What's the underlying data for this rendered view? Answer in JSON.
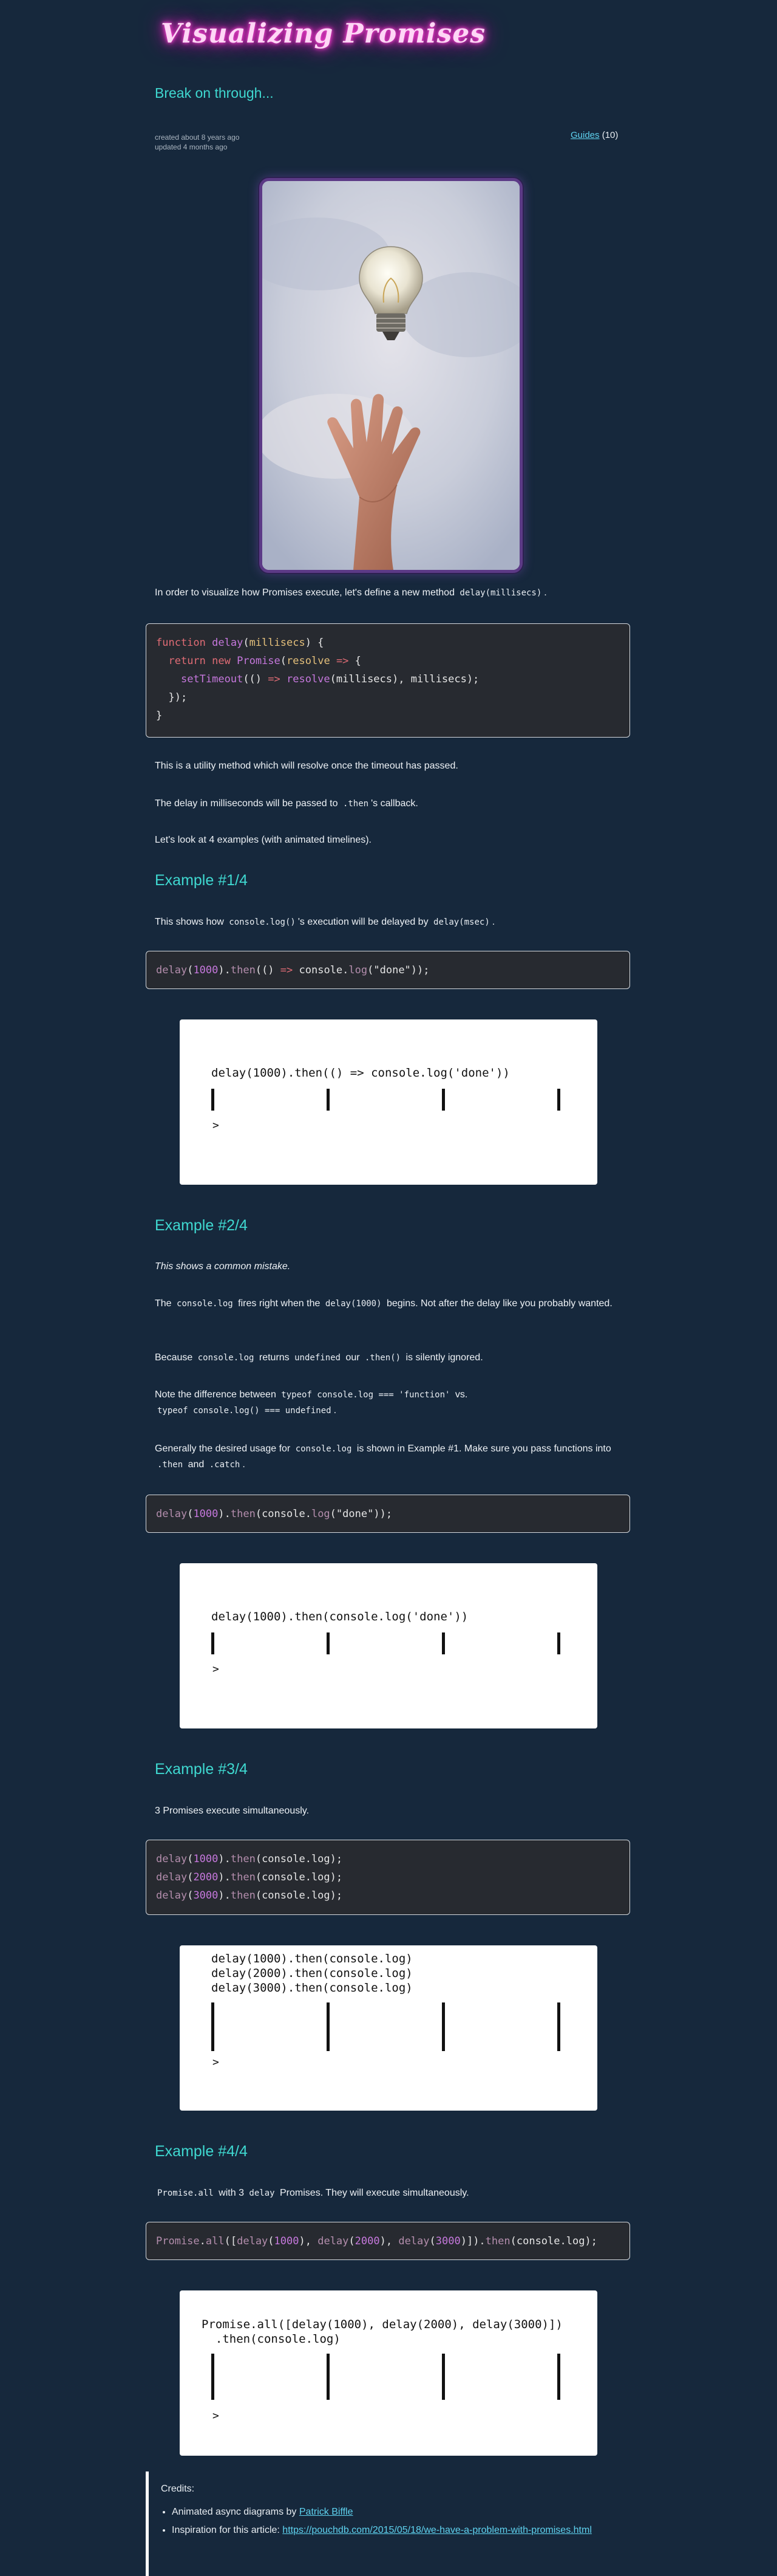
{
  "header": {
    "site_title": "Visualizing Promises",
    "tagline": "Break on through...",
    "created": "created about 8 years ago",
    "updated": "updated 4 months ago",
    "guides_label": "Guides",
    "guides_count": "(10)"
  },
  "intro": {
    "p1_before": "In order to visualize how Promises execute, let's define a new method ",
    "p1_code": "delay(millisecs)",
    "p1_after": ".",
    "p2": "This is a utility method which will resolve once the timeout has passed.",
    "p3_before": "The delay in milliseconds will be passed to ",
    "p3_code": ".then",
    "p3_after": "'s callback.",
    "p4": "Let's look at 4 examples (with animated timelines)."
  },
  "code_delay": {
    "l1_kw": "function",
    "l1_fn": "delay",
    "l1_open": "(",
    "l1_param": "millisecs",
    "l1_close": ") {",
    "l2_kw1": "return",
    "l2_kw2": "new",
    "l2_cls": "Promise",
    "l2_open": "(",
    "l2_param": "resolve",
    "l2_arrow": "=>",
    "l2_brace": " {",
    "l3_fn": "setTimeout",
    "l3_open": "(() ",
    "l3_arrow": "=>",
    "l3_fn2": "resolve",
    "l3_rest": "(millisecs), millisecs);",
    "l4": "});",
    "l5": "}"
  },
  "ex1": {
    "title": "Example #1/4",
    "p_before": "This shows how ",
    "p_code": "console.log()",
    "p_mid": "'s execution will be delayed by ",
    "p_code2": "delay(msec)",
    "p_after": ".",
    "code_fn": "delay",
    "code_num": "1000",
    "code_then": "then",
    "code_arrow": "=>",
    "code_log": "console.",
    "code_logfn": "log",
    "code_str": "\"done\"",
    "code_end": "));",
    "anim_caption": "delay(1000).then(() => console.log('done'))",
    "anim_prompt": ">"
  },
  "ex2": {
    "title": "Example #2/4",
    "italic": "This shows a common mistake.",
    "p1_a": "The ",
    "p1_code": "console.log",
    "p1_b": " fires right when the ",
    "p1_code2": "delay(1000)",
    "p1_c": " begins. Not after the delay like you probably wanted.",
    "p2_a": "Because ",
    "p2_code": "console.log",
    "p2_b": " returns ",
    "p2_code2": "undefined",
    "p2_c": " our ",
    "p2_code3": ".then()",
    "p2_d": " is silently ignored.",
    "p3_a": "Note the difference between ",
    "p3_code": "typeof console.log === 'function'",
    "p3_b": " vs.",
    "p3_code2": "typeof console.log() === undefined",
    "p3_c": ".",
    "p4_a": "Generally the desired usage for ",
    "p4_code": "console.log",
    "p4_b": " is shown in Example #1. Make sure you pass functions into ",
    "p4_code2": ".then",
    "p4_c": " and ",
    "p4_code3": ".catch",
    "p4_d": ".",
    "code_fn": "delay",
    "code_num": "1000",
    "code_then": "then",
    "code_log": "(console.",
    "code_logfn": "log",
    "code_str": "\"done\"",
    "code_end": "));",
    "anim_caption": "delay(1000).then(console.log('done'))",
    "anim_prompt": ">"
  },
  "ex3": {
    "title": "Example #3/4",
    "p": "3 Promises execute simultaneously.",
    "code": [
      {
        "fn": "delay",
        "num": "1000",
        "then": "then",
        "rest": "(console.log);"
      },
      {
        "fn": "delay",
        "num": "2000",
        "then": "then",
        "rest": "(console.log);"
      },
      {
        "fn": "delay",
        "num": "3000",
        "then": "then",
        "rest": "(console.log);"
      }
    ],
    "anim_caption": "delay(1000).then(console.log)\ndelay(2000).then(console.log)\ndelay(3000).then(console.log)",
    "anim_prompt": ">"
  },
  "ex4": {
    "title": "Example #4/4",
    "p_code": "Promise.all",
    "p_mid": " with 3 ",
    "p_code2": "delay",
    "p_after": " Promises. They will execute simultaneously.",
    "code_cls": "Promise",
    "code_all": "all",
    "code_d": "delay",
    "code_n1": "1000",
    "code_n2": "2000",
    "code_n3": "3000",
    "code_then": "then",
    "code_rest": "(console.log);",
    "anim_caption": "Promise.all([delay(1000), delay(2000), delay(3000)])\n  .then(console.log)",
    "anim_prompt": ">"
  },
  "credits": {
    "title": "Credits:",
    "item1_text": "Animated async diagrams by ",
    "item1_link": "Patrick Biffle",
    "item2_text": "Inspiration for this article: ",
    "item2_link": "https://pouchdb.com/2015/05/18/we-have-a-problem-with-promises.html"
  },
  "colors": {
    "background": "#16283c",
    "accent": "#3fd8d0",
    "link": "#5fd3f0",
    "title_glow": "#ff2fcf"
  }
}
